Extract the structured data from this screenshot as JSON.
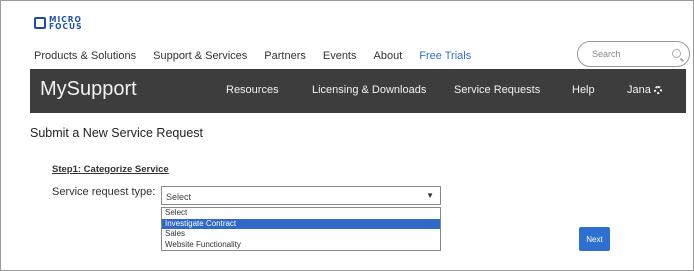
{
  "logo": {
    "text": "MICRO\nFOCUS"
  },
  "topnav": {
    "items": [
      "Products & Solutions",
      "Support & Services",
      "Partners",
      "Events",
      "About",
      "Free Trials"
    ]
  },
  "search": {
    "placeholder": "Search"
  },
  "header_bar": {
    "brand": "MySupport",
    "items": [
      "Resources",
      "Licensing & Downloads",
      "Service Requests",
      "Help"
    ],
    "user": "Jana"
  },
  "page_title": "Submit a New Service Request",
  "step_label": "Step1: Categorize Service",
  "form": {
    "label": "Service request type:",
    "selected": "Select",
    "options": [
      "Select",
      "Investigate Contract",
      "Sales",
      "Website Functionality"
    ],
    "highlighted_option": "Investigate Contract"
  },
  "next_label": "Next",
  "colors": {
    "accent": "#2f6fd0",
    "nav_bar": "#3d3d3d",
    "highlight": "#2f68c7"
  },
  "icons": {
    "search": "search-icon",
    "gear": "gear-icon",
    "dropdown": "caret-down-icon"
  }
}
